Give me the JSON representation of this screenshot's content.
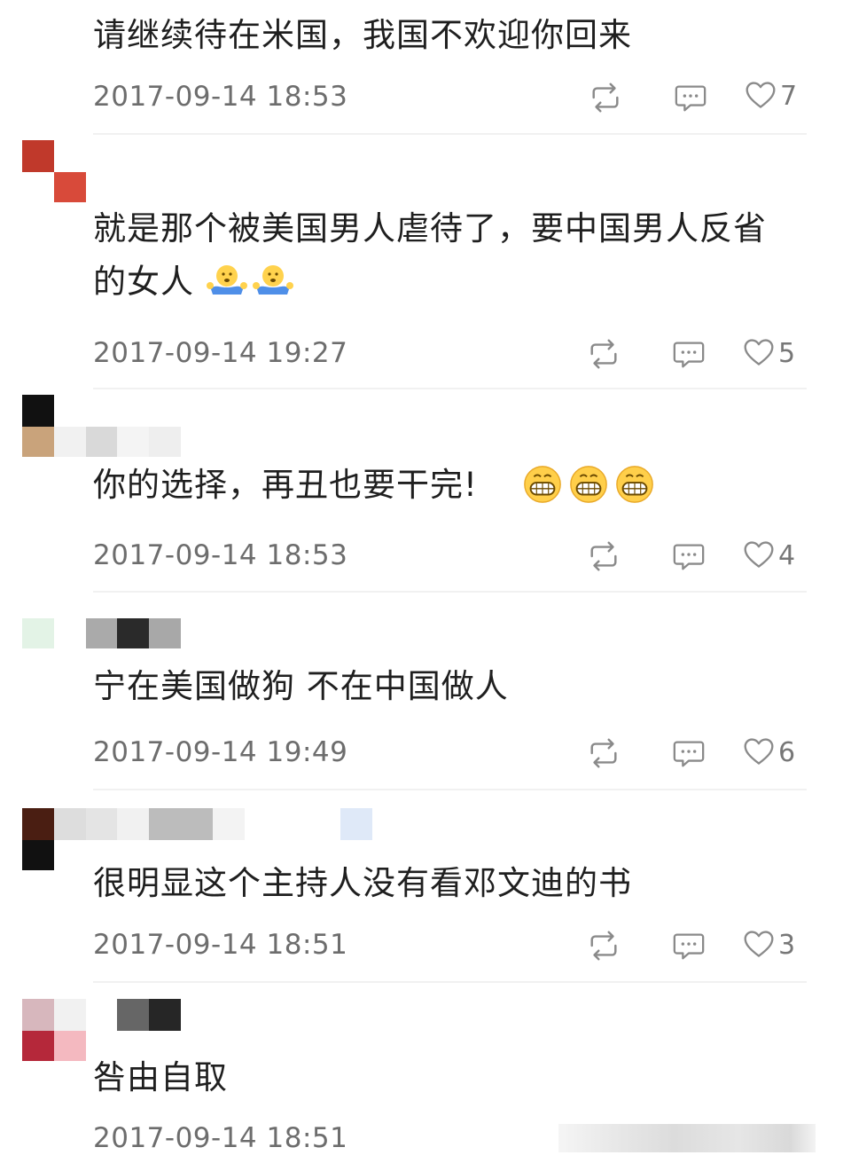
{
  "colors": {
    "text": "#1f1f1f",
    "meta": "#6d6d6d",
    "icon": "#8a8a8a",
    "divider": "#f1f1f1"
  },
  "icons": {
    "repost": "repost-icon",
    "comment": "comment-icon",
    "like": "heart-icon",
    "emoji_shrug": "shrug-emoji",
    "emoji_grin": "grin-emoji"
  },
  "comments": [
    {
      "text": "请继续待在米国，我国不欢迎你回来",
      "time": "2017-09-14 18:53",
      "likes": "7"
    },
    {
      "text_line1": "就是那个被美国男人虐待了，要中国男人反省",
      "text_line2": "的女人",
      "time": "2017-09-14 19:27",
      "likes": "5"
    },
    {
      "text": "你的选择，再丑也要干完!",
      "time": "2017-09-14 18:53",
      "likes": "4"
    },
    {
      "text": "宁在美国做狗 不在中国做人",
      "time": "2017-09-14 19:49",
      "likes": "6"
    },
    {
      "text": "很明显这个主持人没有看邓文迪的书",
      "time": "2017-09-14 18:51",
      "likes": "3"
    },
    {
      "text": "咎由自取",
      "time": "2017-09-14 18:51"
    }
  ]
}
